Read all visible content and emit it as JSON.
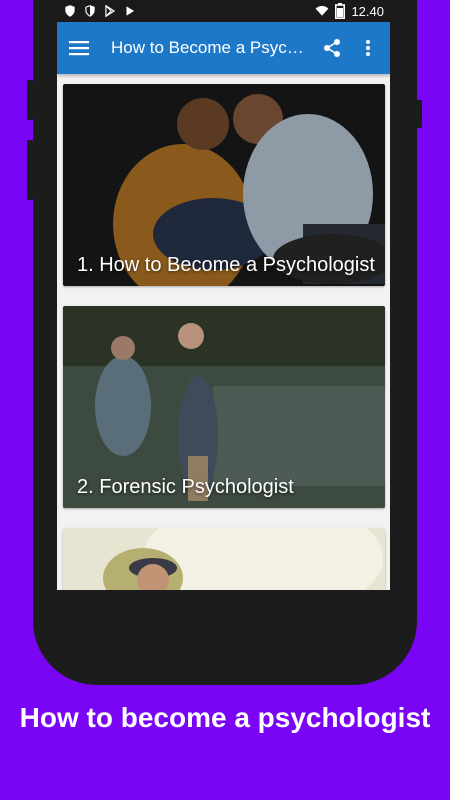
{
  "status_bar": {
    "time": "12.40",
    "left_icons": [
      "shield-icon",
      "shield-icon",
      "play-store-icon",
      "play-icon"
    ],
    "right_icons": [
      "wifi-icon",
      "battery-icon"
    ]
  },
  "app_bar": {
    "title": "How to Become a Psychologist",
    "menu_icon": "hamburger-menu-icon",
    "share_icon": "share-icon",
    "overflow_icon": "more-vert-icon"
  },
  "cards": [
    {
      "title": "1. How to Become a Psychologist"
    },
    {
      "title": "2. Forensic Psychologist"
    },
    {
      "title": ""
    }
  ],
  "promo_caption": "How to become a psychologist",
  "colors": {
    "background": "#7a04f4",
    "app_bar": "#1e78c8",
    "status_bar": "#1a1a1a",
    "phone_frame": "#1c1c1c"
  }
}
